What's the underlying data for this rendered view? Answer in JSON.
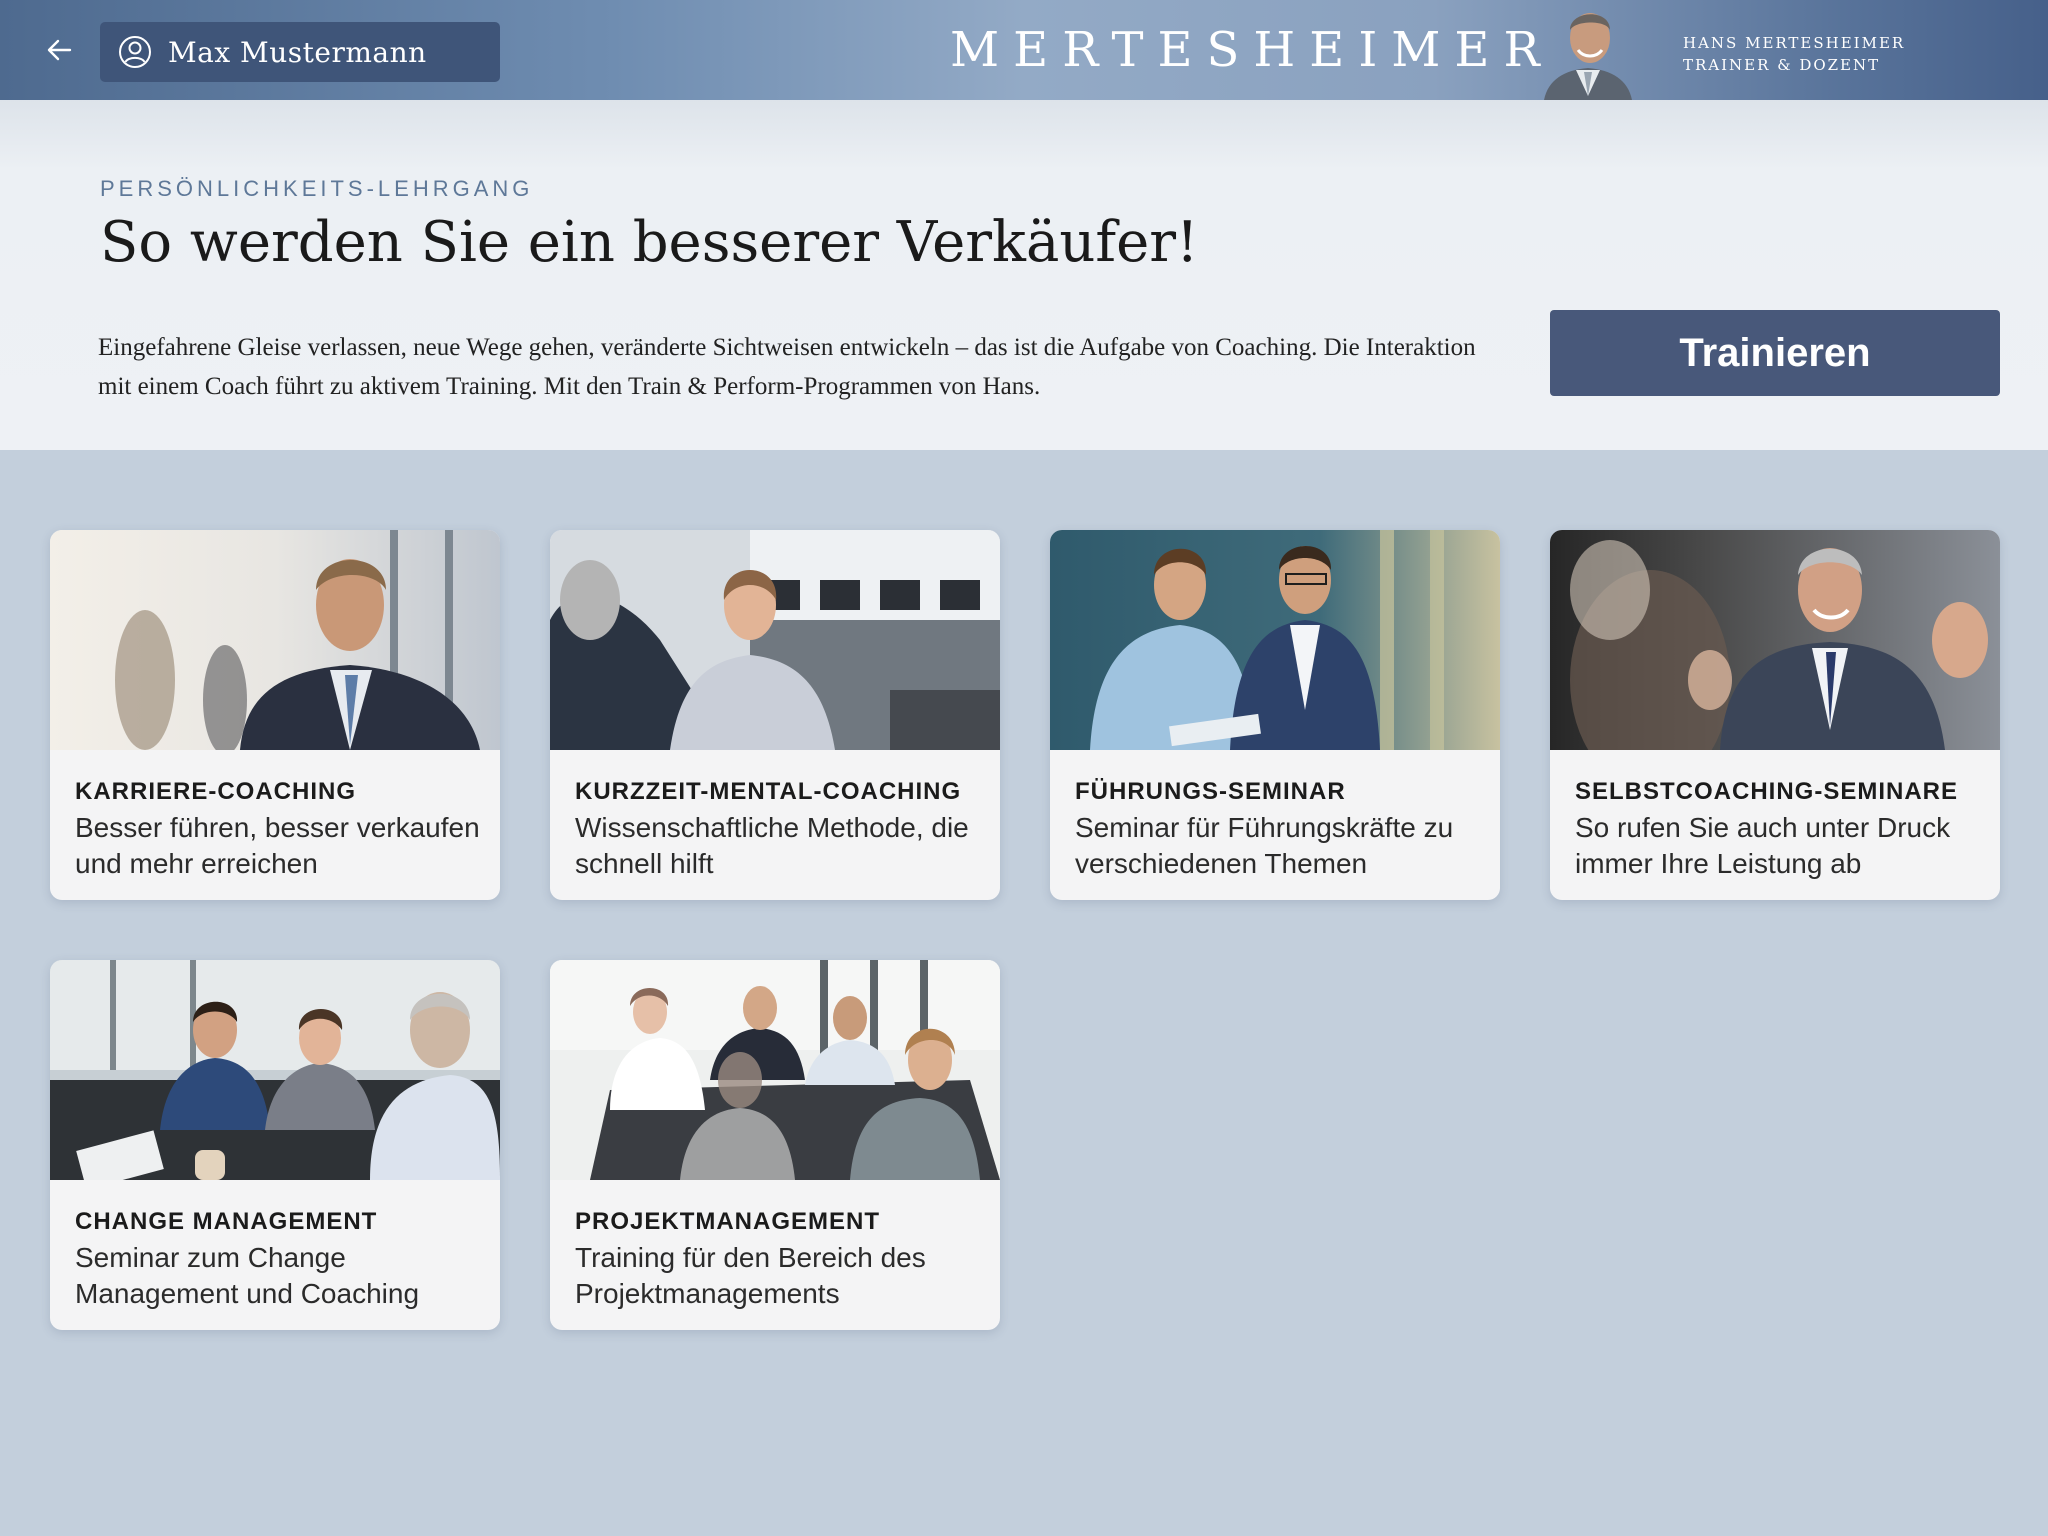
{
  "header": {
    "user_name": "Max Mustermann",
    "brand": "MERTESHEIMER",
    "trainer_name": "HANS MERTESHEIMER",
    "trainer_role": "TRAINER & DOZENT"
  },
  "hero": {
    "eyebrow": "PERSÖNLICHKEITS-LEHRGANG",
    "title": "So werden Sie ein besserer Verkäufer!",
    "text": "Eingefahrene Gleise verlassen, neue Wege gehen, veränderte Sichtweisen entwickeln – das ist die Aufgabe von Coaching. Die Interaktion mit einem Coach führt zu aktivem Training. Mit den Train & Perform-Programmen von Hans.",
    "button_label": "Trainieren"
  },
  "cards": [
    {
      "title": "KARRIERE-COACHING",
      "desc": "Besser führen, besser verkaufen und mehr erreichen",
      "image": "businessman-portrait-photo"
    },
    {
      "title": "KURZZEIT-MENTAL-COACHING",
      "desc": "Wissenschaftliche Methode, die schnell hilft",
      "image": "office-conversation-photo"
    },
    {
      "title": "FÜHRUNGS-SEMINAR",
      "desc": "Seminar für Führungskräfte zu verschiedenen Themen",
      "image": "two-businessmen-photo"
    },
    {
      "title": "SELBSTCOACHING-SEMINARE",
      "desc": "So rufen Sie auch unter Druck immer Ihre Leistung ab",
      "image": "smiling-coach-photo"
    },
    {
      "title": "CHANGE MANAGEMENT",
      "desc": "Seminar zum Change Management und Coaching",
      "image": "meeting-table-photo"
    },
    {
      "title": "PROJEKTMANAGEMENT",
      "desc": "Training für den Bereich des Projektmanagements",
      "image": "conference-room-photo"
    }
  ],
  "colors": {
    "header_dark": "#3f5579",
    "accent_button": "#48587a",
    "eyebrow": "#5e7898",
    "page_bg": "#c3cfdc",
    "card_bg": "#f4f4f5"
  }
}
